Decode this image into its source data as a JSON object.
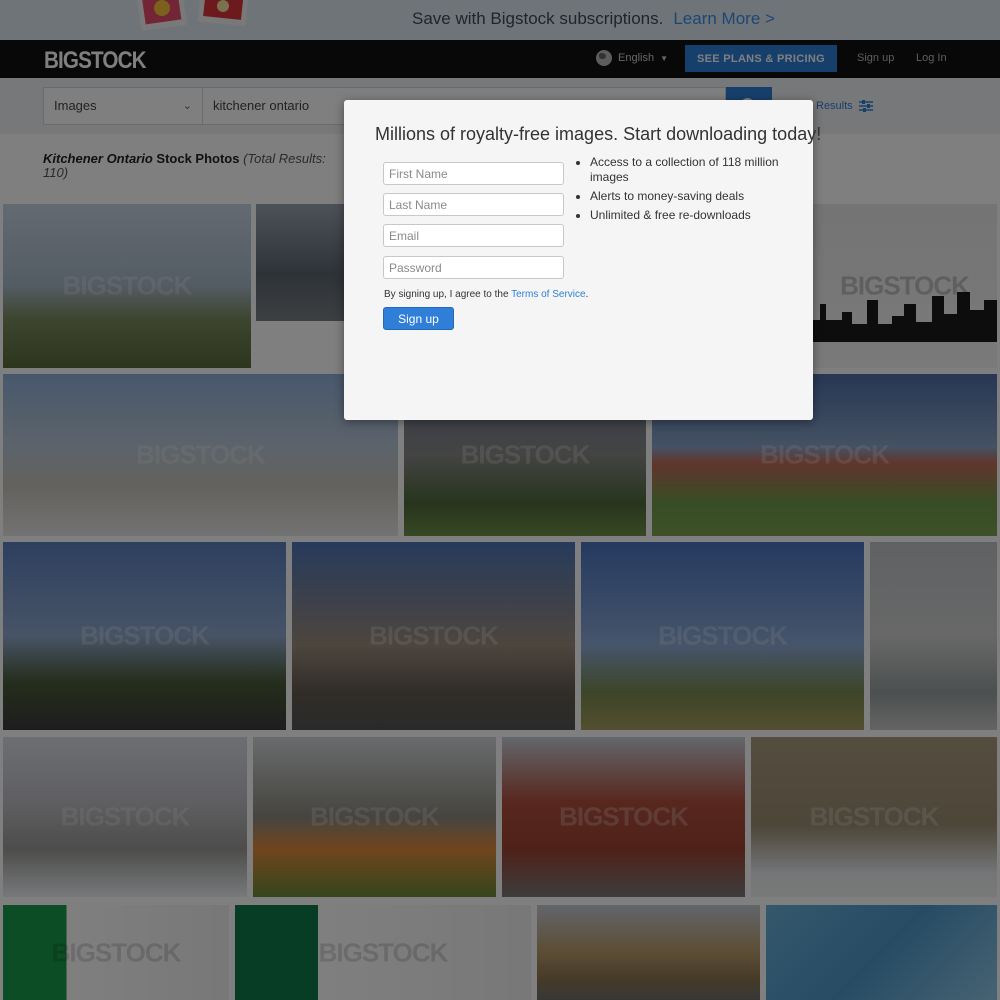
{
  "banner": {
    "text": "Save with Bigstock subscriptions.",
    "link": "Learn More >"
  },
  "header": {
    "logo": "BIGSTOCK",
    "language": "English",
    "plans_button": "SEE PLANS & PRICING",
    "signup_link": "Sign up",
    "login_link": "Log In"
  },
  "search": {
    "type": "Images",
    "query": "kitchener ontario",
    "filters_label": "Results"
  },
  "results": {
    "title_italic": "Kitchener Ontario",
    "title_rest": " Stock Photos ",
    "count_text": "(Total Results: 110)"
  },
  "gallery": {
    "watermark": "BIGSTOCK"
  },
  "modal": {
    "title": "Millions of royalty-free images. Start downloading today!",
    "first_name_placeholder": "First Name",
    "last_name_placeholder": "Last Name",
    "email_placeholder": "Email",
    "password_placeholder": "Password",
    "terms_prefix": "By signing up, I agree to the ",
    "terms_link": "Terms of Service",
    "terms_suffix": ".",
    "signup_button": "Sign up",
    "benefits": [
      "Access to a collection of 118 million images",
      "Alerts to money-saving deals",
      "Unlimited & free re-downloads"
    ]
  }
}
